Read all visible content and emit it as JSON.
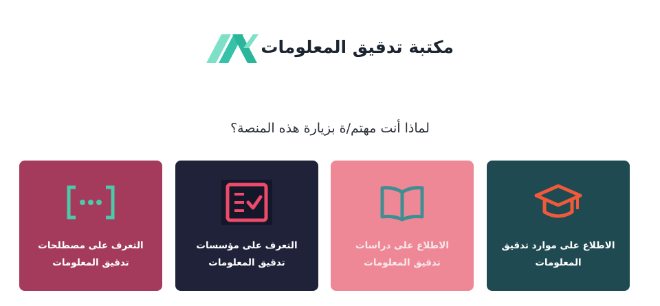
{
  "header": {
    "title": "مكتبة تدقيق المعلومات",
    "logo_icon": "ax-logo-icon",
    "logo_color": "#3cc8b0"
  },
  "question": "لماذا أنت مهتم/ة بزيارة هذه المنصة؟",
  "cards": [
    {
      "label": "الاطلاع على موارد تدقيق المعلومات",
      "icon": "graduation-cap-icon",
      "bg": "#1f4a52",
      "icon_color": "#f05a3a"
    },
    {
      "label": "الاطلاع على دراسات تدقيق المعلومات",
      "icon": "open-book-icon",
      "bg": "#ef8896",
      "icon_color": "#3f8e91"
    },
    {
      "label": "التعرف على مؤسسات تدقيق المعلومات",
      "icon": "checklist-icon",
      "bg": "#1f2238",
      "icon_color": "#ee4a6a"
    },
    {
      "label": "التعرف على مصطلحات تدقيق المعلومات",
      "icon": "brackets-dots-icon",
      "bg": "#a43a5c",
      "icon_color": "#4cc9a8"
    }
  ]
}
